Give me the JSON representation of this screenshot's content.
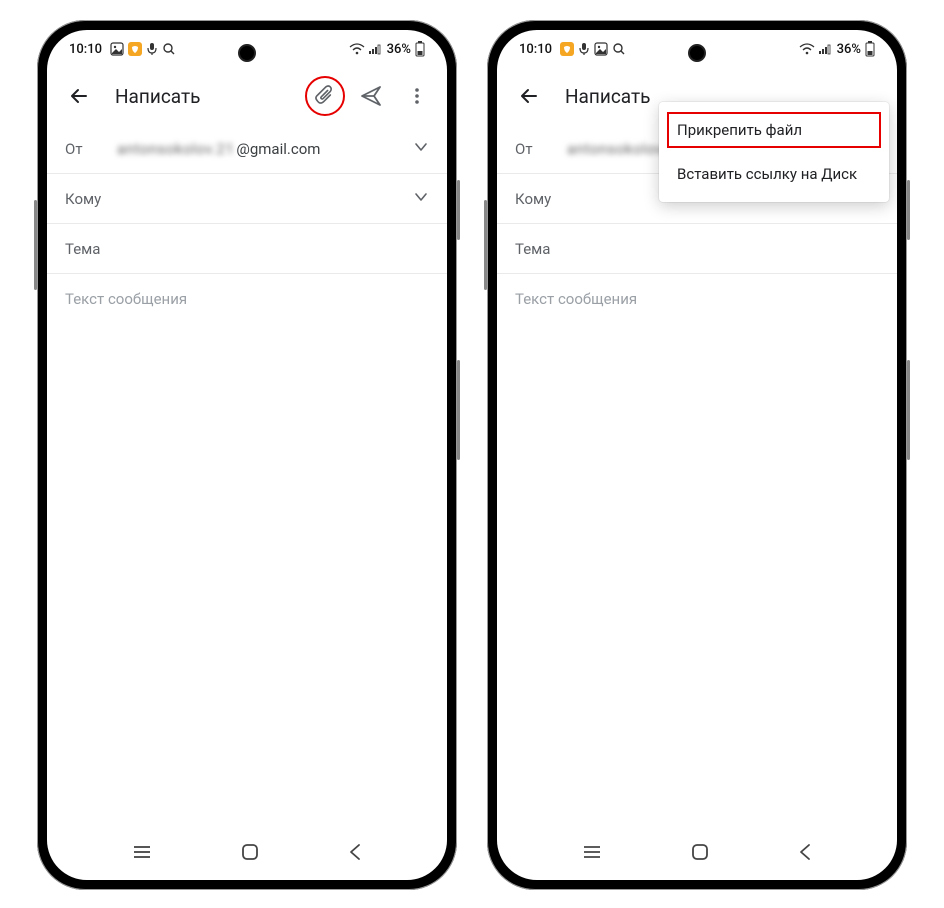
{
  "status": {
    "time": "10:10",
    "battery_pct": "36%"
  },
  "compose": {
    "title": "Написать",
    "from_label": "От",
    "from_value_blur": "antonsokolov.21",
    "from_value_suffix": "@gmail.com",
    "to_label": "Кому",
    "subject_label": "Тема",
    "body_placeholder": "Текст сообщения"
  },
  "popup": {
    "attach_file": "Прикрепить файл",
    "drive_link": "Вставить ссылку на Диск"
  }
}
